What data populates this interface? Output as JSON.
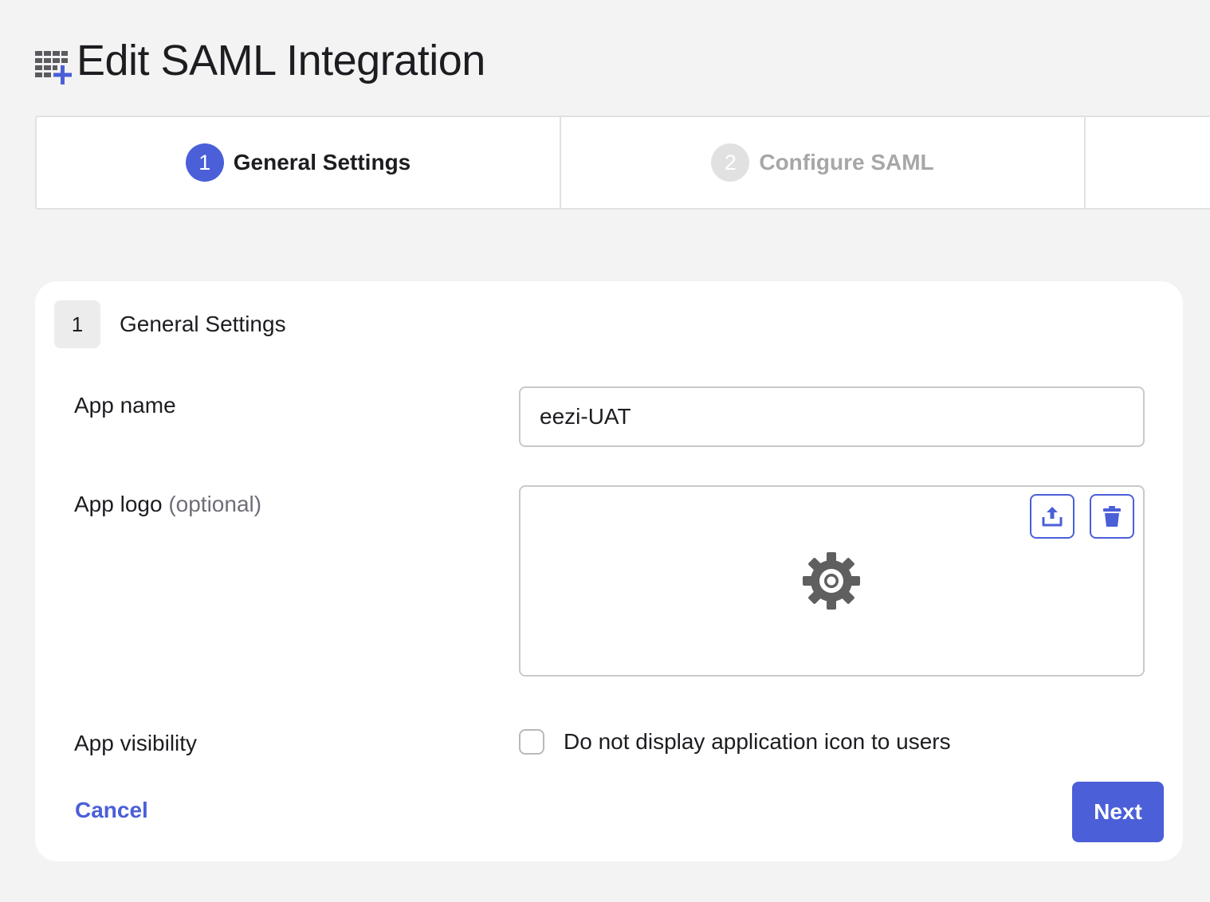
{
  "header": {
    "title": "Edit SAML Integration",
    "icon": "apps-add-icon",
    "accent_color": "#4b5fd8"
  },
  "stepper": {
    "steps": [
      {
        "number": "1",
        "label": "General Settings",
        "state": "active"
      },
      {
        "number": "2",
        "label": "Configure SAML",
        "state": "inactive"
      }
    ]
  },
  "section": {
    "number": "1",
    "title": "General Settings"
  },
  "form": {
    "app_name": {
      "label": "App name",
      "value": "eezi-UAT"
    },
    "app_logo": {
      "label": "App logo",
      "optional": "(optional)",
      "upload_icon": "upload-icon",
      "delete_icon": "trash-icon",
      "placeholder_icon": "gear-icon"
    },
    "app_visibility": {
      "label": "App visibility",
      "checkbox_label": "Do not display application icon to users",
      "checked": false
    }
  },
  "actions": {
    "cancel_label": "Cancel",
    "next_label": "Next"
  }
}
